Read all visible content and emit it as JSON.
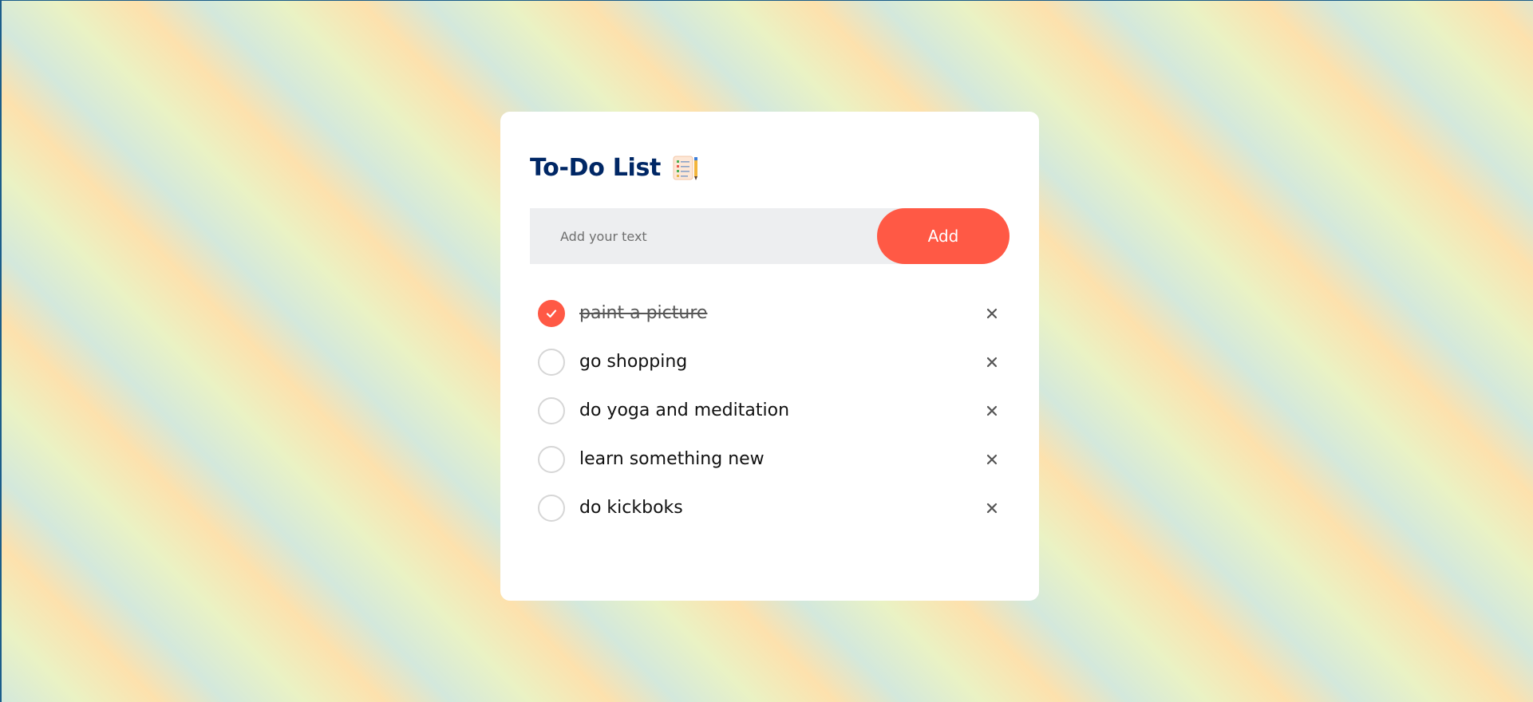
{
  "app": {
    "title": "To-Do List",
    "title_icon": "notepad-checklist-icon"
  },
  "input": {
    "placeholder": "Add your text",
    "value": "",
    "add_label": "Add"
  },
  "tasks": [
    {
      "label": "paint a picture",
      "checked": true
    },
    {
      "label": "go shopping",
      "checked": false
    },
    {
      "label": "do yoga and meditation",
      "checked": false
    },
    {
      "label": "learn something new",
      "checked": false
    },
    {
      "label": "do kickboks",
      "checked": false
    }
  ],
  "icons": {
    "check": "checkmark-icon",
    "remove": "close-icon"
  },
  "colors": {
    "accent": "#ff5945",
    "title": "#002765",
    "input_bg": "#edeef0",
    "unchecked_border": "#d6d6d6"
  }
}
